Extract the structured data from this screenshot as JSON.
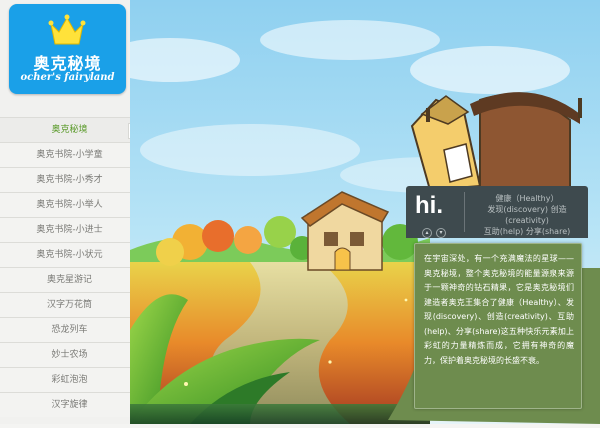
{
  "logo": {
    "name_cn": "奥克秘境",
    "name_en": "ocher's fairyland",
    "icon": "crown-icon"
  },
  "nav": {
    "items": [
      {
        "label": "奥克秘境",
        "active": true
      },
      {
        "label": "奥克书院-小学童",
        "active": false
      },
      {
        "label": "奥克书院-小秀才",
        "active": false
      },
      {
        "label": "奥克书院-小举人",
        "active": false
      },
      {
        "label": "奥克书院-小进士",
        "active": false
      },
      {
        "label": "奥克书院-小状元",
        "active": false
      },
      {
        "label": "奥克星游记",
        "active": false
      },
      {
        "label": "汉字万花筒",
        "active": false
      },
      {
        "label": "恐龙列车",
        "active": false
      },
      {
        "label": "妙士农场",
        "active": false
      },
      {
        "label": "彩虹泡泡",
        "active": false
      },
      {
        "label": "汉字旋律",
        "active": false
      }
    ],
    "active_arrow": "▸"
  },
  "panel": {
    "hi": "hi.",
    "lines": [
      "健康（Healthy）",
      "发现(discovery) 创造(creativity)",
      "互助(help) 分享(share)"
    ],
    "dot_up": "▴",
    "dot_down": "▾",
    "description": "在宇宙深处，有一个充满魔法的星球——奥克秘境，整个奥克秘境的能量源泉来源于一颗神奇的钻石精果，它是奥克秘境们建造者奥克王集合了健康（Healthy）、发现(discovery)、创造(creativity)、互助(help)、分享(share)这五种快乐元素加上彩虹的力量精炼而成，它拥有神奇的魔力，保护着奥克秘境的长盛不衰。"
  },
  "colors": {
    "logo_bg": "#1aa0e8",
    "nav_active": "#5a9a2a",
    "hi_bg": "#3e4a4e",
    "desc_bg": "#6e8c4e"
  }
}
